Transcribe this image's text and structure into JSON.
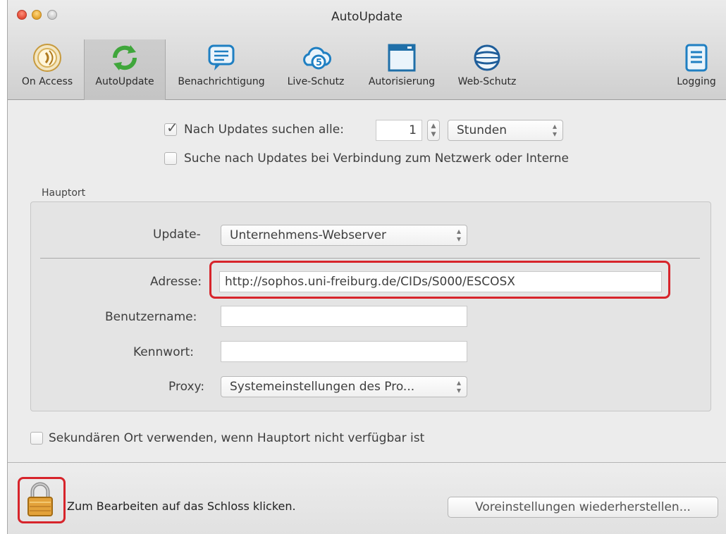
{
  "window": {
    "title": "AutoUpdate"
  },
  "toolbar": {
    "items": [
      {
        "label": "On Access",
        "icon": "on-access-icon"
      },
      {
        "label": "AutoUpdate",
        "icon": "autoupdate-refresh-icon"
      },
      {
        "label": "Benachrichtigung",
        "icon": "speech-bubble-icon"
      },
      {
        "label": "Live-Schutz",
        "icon": "cloud-shield-icon"
      },
      {
        "label": "Autorisierung",
        "icon": "window-app-icon"
      },
      {
        "label": "Web-Schutz",
        "icon": "globe-icon"
      },
      {
        "label": "Logging",
        "icon": "list-document-icon"
      }
    ],
    "selected": "AutoUpdate"
  },
  "schedule": {
    "check_label": "Nach Updates suchen alle:",
    "checked": true,
    "interval_value": "1",
    "interval_unit": "Stunden",
    "network_label": "Suche nach Updates bei Verbindung zum Netzwerk oder Interne",
    "network_checked": false
  },
  "primary": {
    "group_label": "Hauptort",
    "update_from_label": "Update-",
    "update_from_value": "Unternehmens-Webserver",
    "address_label": "Adresse:",
    "address_value": "http://sophos.uni-freiburg.de/CIDs/S000/ESCOSX",
    "username_label": "Benutzername:",
    "username_value": "",
    "password_label": "Kennwort:",
    "password_value": "",
    "proxy_label": "Proxy:",
    "proxy_value": "Systemeinstellungen des Pro..."
  },
  "secondary": {
    "label": "Sekundären Ort verwenden, wenn Hauptort nicht verfügbar ist",
    "checked": false
  },
  "footer": {
    "lock_text": "Zum Bearbeiten auf das Schloss klicken.",
    "restore_button": "Voreinstellungen wiederherstellen..."
  },
  "colors": {
    "highlight": "#d7242b",
    "selected_tab": "#c8c8c8"
  }
}
